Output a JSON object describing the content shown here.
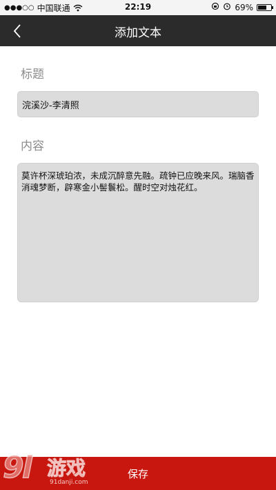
{
  "status_bar": {
    "carrier": "中国联通",
    "time": "22:19",
    "battery_percent": "69%",
    "battery_level": 0.69
  },
  "nav": {
    "title": "添加文本"
  },
  "form": {
    "title_label": "标题",
    "title_value": "浣溪沙-李清照",
    "content_label": "内容",
    "content_value": "莫许杯深琥珀浓，未成沉醉意先融。疏钟已应晚来风。瑞脑香消魂梦断，辟寒金小髻鬟松。醒时空对烛花红。"
  },
  "footer": {
    "save_label": "保存"
  },
  "watermark": {
    "brand": "91游戏",
    "site": "91danji.com"
  },
  "colors": {
    "nav_background": "#2b2b2b",
    "save_background": "#c8170f",
    "field_background": "#dcdcdc",
    "label_text": "#8c8c8c"
  }
}
